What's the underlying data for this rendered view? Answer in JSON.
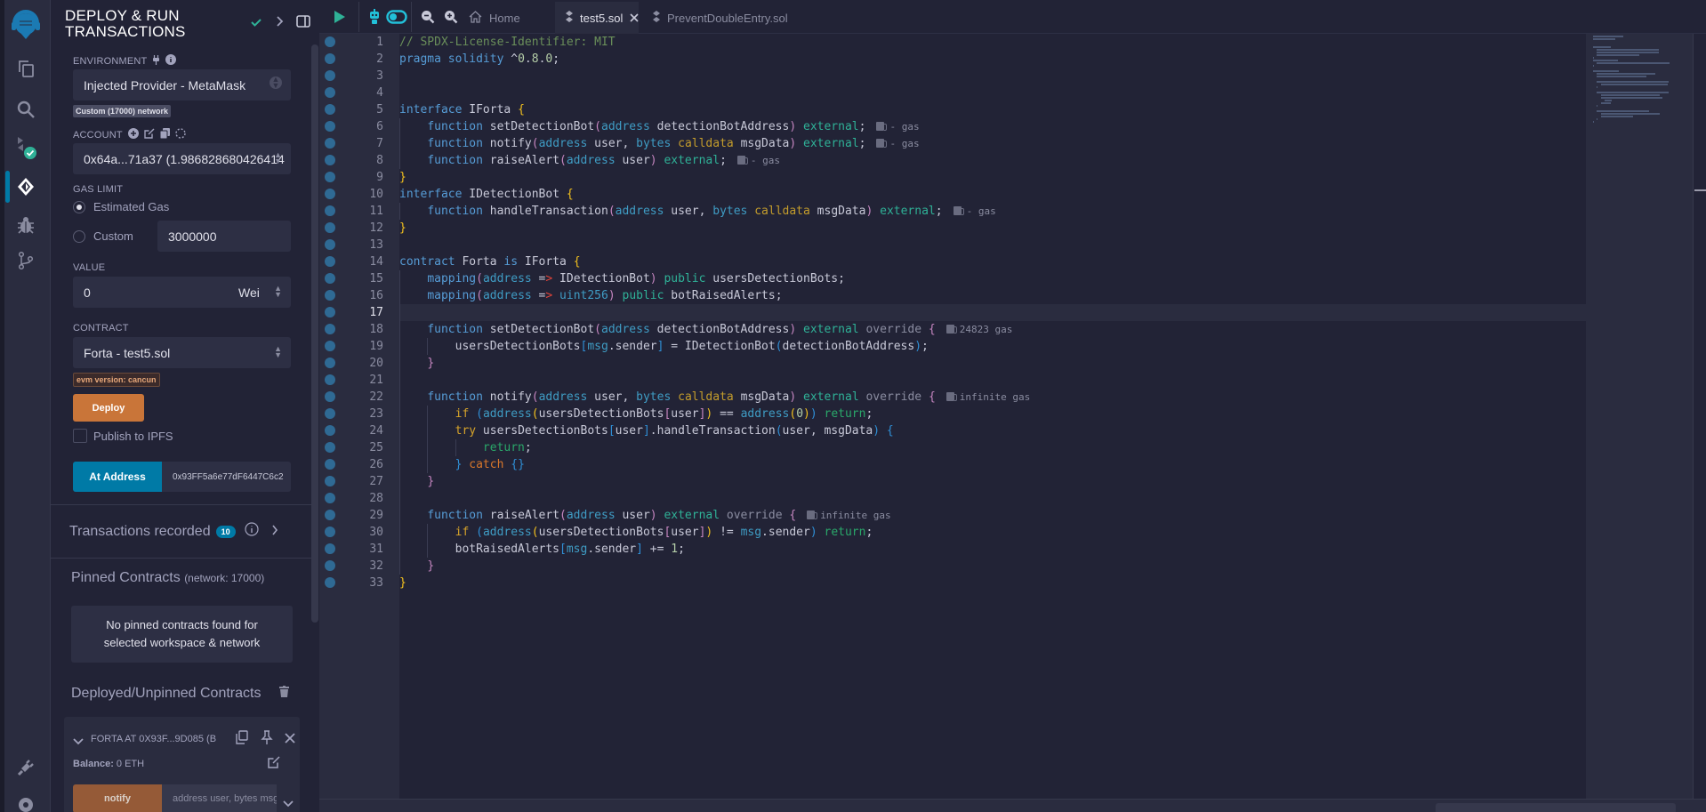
{
  "colors": {
    "accent": "#007aa6",
    "deploy": "#c97539",
    "transact": "#955a37",
    "success": "#2fb197"
  },
  "rail": {
    "items": [
      {
        "name": "remix-logo",
        "icon": "remix-logo-icon"
      },
      {
        "name": "file-explorer",
        "icon": "files-icon"
      },
      {
        "name": "search",
        "icon": "search-icon"
      },
      {
        "name": "solidity-compiler",
        "icon": "compiler-icon"
      },
      {
        "name": "deploy-run",
        "icon": "deploy-icon"
      },
      {
        "name": "debugger",
        "icon": "bug-icon"
      },
      {
        "name": "git",
        "icon": "git-branch-icon"
      },
      {
        "name": "plugin-manager",
        "icon": "plug-icon"
      },
      {
        "name": "settings",
        "icon": "gear-icon"
      }
    ]
  },
  "panel": {
    "title_line1": "DEPLOY & RUN",
    "title_line2": "TRANSACTIONS",
    "environment": {
      "label": "ENVIRONMENT",
      "value": "Injected Provider - MetaMask",
      "network_badge": "Custom (17000) network"
    },
    "account": {
      "label": "ACCOUNT",
      "value": "0x64a...71a37 (1.986828680426414"
    },
    "gas_limit": {
      "label": "GAS LIMIT",
      "estimated_label": "Estimated Gas",
      "custom_label": "Custom",
      "custom_value": "3000000",
      "selected": "estimated"
    },
    "value": {
      "label": "VALUE",
      "amount": "0",
      "unit": "Wei"
    },
    "contract": {
      "label": "CONTRACT",
      "value": "Forta - test5.sol",
      "evm_badge": "evm version: cancun"
    },
    "deploy_label": "Deploy",
    "publish_ipfs_label": "Publish to IPFS",
    "publish_ipfs_checked": false,
    "at_address_label": "At Address",
    "at_address_value": "0x93FF5a6e77dF6447C6c2",
    "transactions_recorded": {
      "label": "Transactions recorded",
      "count": "10"
    },
    "pinned": {
      "title": "Pinned Contracts",
      "network": "(network: 17000)",
      "empty_message_line1": "No pinned contracts found for",
      "empty_message_line2": "selected workspace & network"
    },
    "deployed": {
      "title": "Deployed/Unpinned Contracts",
      "instance_title": "FORTA AT 0X93F...9D085 (B",
      "balance_label": "Balance:",
      "balance_value": "0 ETH",
      "function_label": "notify",
      "function_placeholder": "address user, bytes msgData"
    }
  },
  "editor": {
    "tabs": [
      {
        "label": "Home",
        "icon": "home-icon",
        "active": false
      },
      {
        "label": "test5.sol",
        "icon": "solidity-icon",
        "active": true,
        "closable": true
      },
      {
        "label": "PreventDoubleEntry.sol",
        "icon": "solidity-icon",
        "active": false
      }
    ],
    "current_line": 17,
    "gas_annotations": {
      "6": "- gas",
      "7": "- gas",
      "8": "- gas",
      "11": "- gas",
      "18": "24823 gas",
      "22": "infinite gas",
      "29": "infinite gas"
    },
    "lines": [
      "// SPDX-License-Identifier: MIT",
      "pragma solidity ^0.8.0;",
      "",
      "",
      "interface IForta {",
      "    function setDetectionBot(address detectionBotAddress) external;",
      "    function notify(address user, bytes calldata msgData) external;",
      "    function raiseAlert(address user) external;",
      "}",
      "interface IDetectionBot {",
      "    function handleTransaction(address user, bytes calldata msgData) external;",
      "}",
      "",
      "contract Forta is IForta {",
      "    mapping(address => IDetectionBot) public usersDetectionBots;",
      "    mapping(address => uint256) public botRaisedAlerts;",
      "",
      "    function setDetectionBot(address detectionBotAddress) external override {",
      "        usersDetectionBots[msg.sender] = IDetectionBot(detectionBotAddress);",
      "    }",
      "",
      "    function notify(address user, bytes calldata msgData) external override {",
      "        if (address(usersDetectionBots[user]) == address(0)) return;",
      "        try usersDetectionBots[user].handleTransaction(user, msgData) {",
      "            return;",
      "        } catch {}",
      "    }",
      "",
      "    function raiseAlert(address user) external override {",
      "        if (address(usersDetectionBots[user]) != msg.sender) return;",
      "        botRaisedAlerts[msg.sender] += 1;",
      "    }",
      "}"
    ]
  }
}
